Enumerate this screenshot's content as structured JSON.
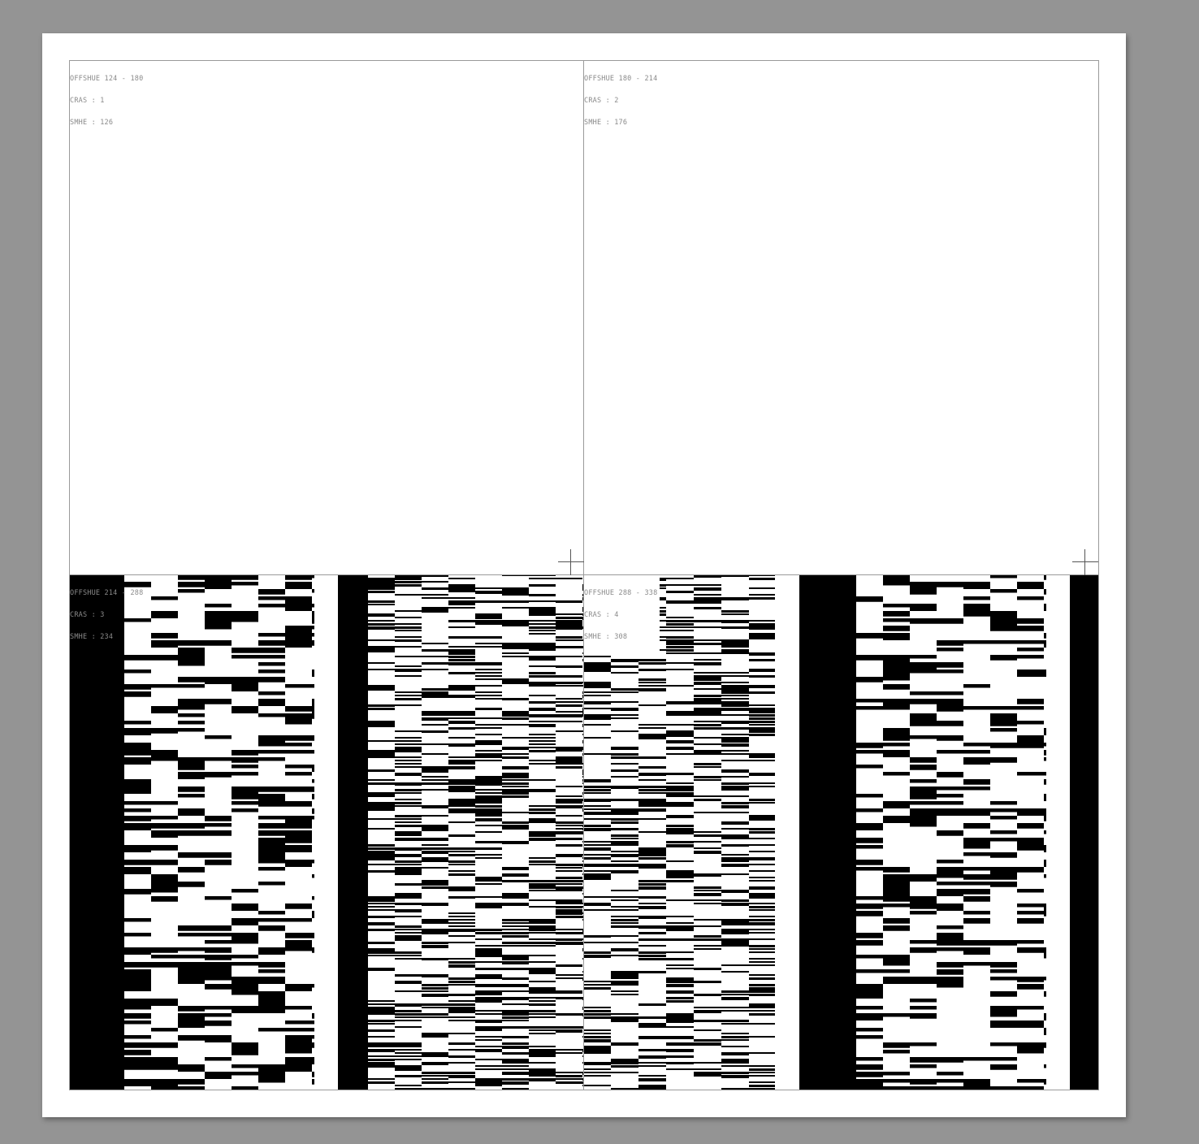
{
  "colors": {
    "background": "#949494",
    "paper": "#ffffff",
    "ink": "#000000",
    "label": "#8a8a8a",
    "frame": "#9a9a9a"
  },
  "tiles": [
    {
      "id": "tl",
      "label": {
        "line1": "OFFSHUE 124 - 180",
        "line2": "CRAS : 1",
        "line3": "SMHE : 126"
      }
    },
    {
      "id": "tr",
      "label": {
        "line1": "OFFSHUE 180 - 214",
        "line2": "CRAS : 2",
        "line3": "SMHE : 176"
      }
    },
    {
      "id": "bl",
      "label": {
        "line1": "OFFSHUE 214 - 288",
        "line2": "CRAS : 3",
        "line3": "SMHE : 234"
      }
    },
    {
      "id": "br",
      "label": {
        "line1": "OFFSHUE 288 - 338",
        "line2": "CRAS : 4",
        "line3": "SMHE : 308"
      }
    }
  ]
}
